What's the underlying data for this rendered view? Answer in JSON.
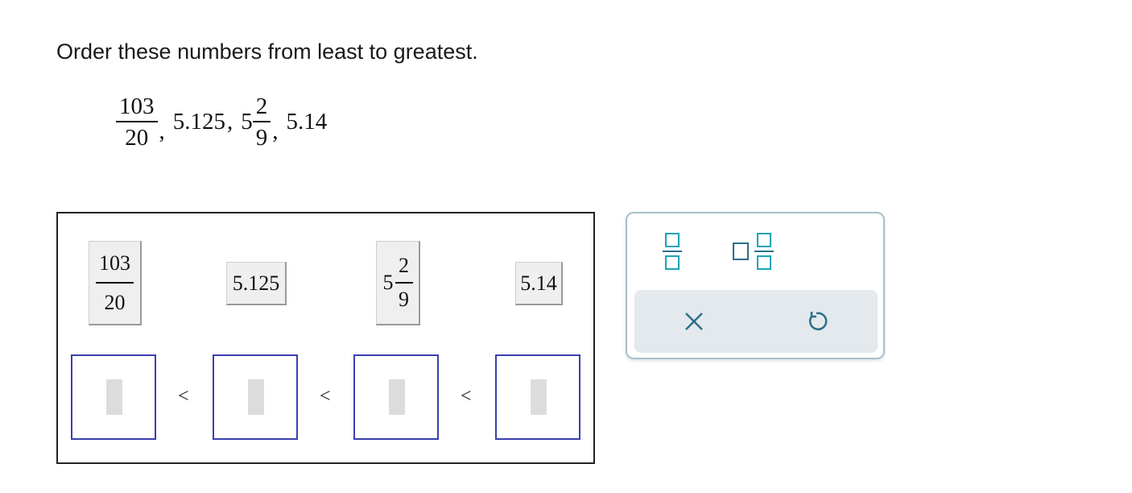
{
  "question": {
    "prompt": "Order these numbers from least to greatest.",
    "numbers": {
      "first": {
        "numerator": "103",
        "denominator": "20"
      },
      "second": "5.125",
      "third": {
        "whole": "5",
        "numerator": "2",
        "denominator": "9"
      },
      "fourth": "5.14",
      "separator": ","
    }
  },
  "tiles": {
    "tile1": {
      "numerator": "103",
      "denominator": "20"
    },
    "tile2": {
      "value": "5.125"
    },
    "tile3": {
      "whole": "5",
      "numerator": "2",
      "denominator": "9"
    },
    "tile4": {
      "value": "5.14"
    }
  },
  "comparison": {
    "symbol": "<"
  },
  "toolbar": {
    "fraction_tool": "fraction-icon",
    "mixed_number_tool": "mixed-number-icon",
    "clear_action": "close-icon",
    "undo_action": "undo-icon",
    "accent_color": "#1aa4b8",
    "icon_color": "#2b6f8a"
  }
}
